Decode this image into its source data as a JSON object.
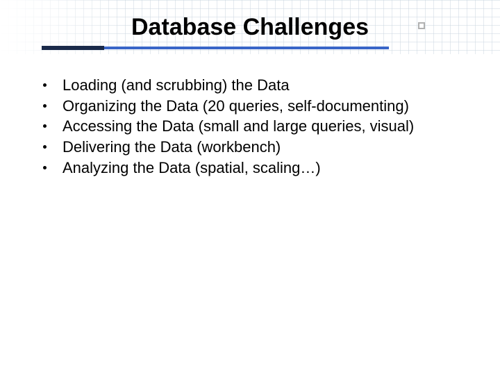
{
  "title": "Database Challenges",
  "bullets": [
    "Loading (and scrubbing) the Data",
    "Organizing the Data (20 queries, self-documenting)",
    "Accessing the Data (small and large queries, visual)",
    "Delivering the Data (workbench)",
    "Analyzing the Data (spatial, scaling…)"
  ]
}
